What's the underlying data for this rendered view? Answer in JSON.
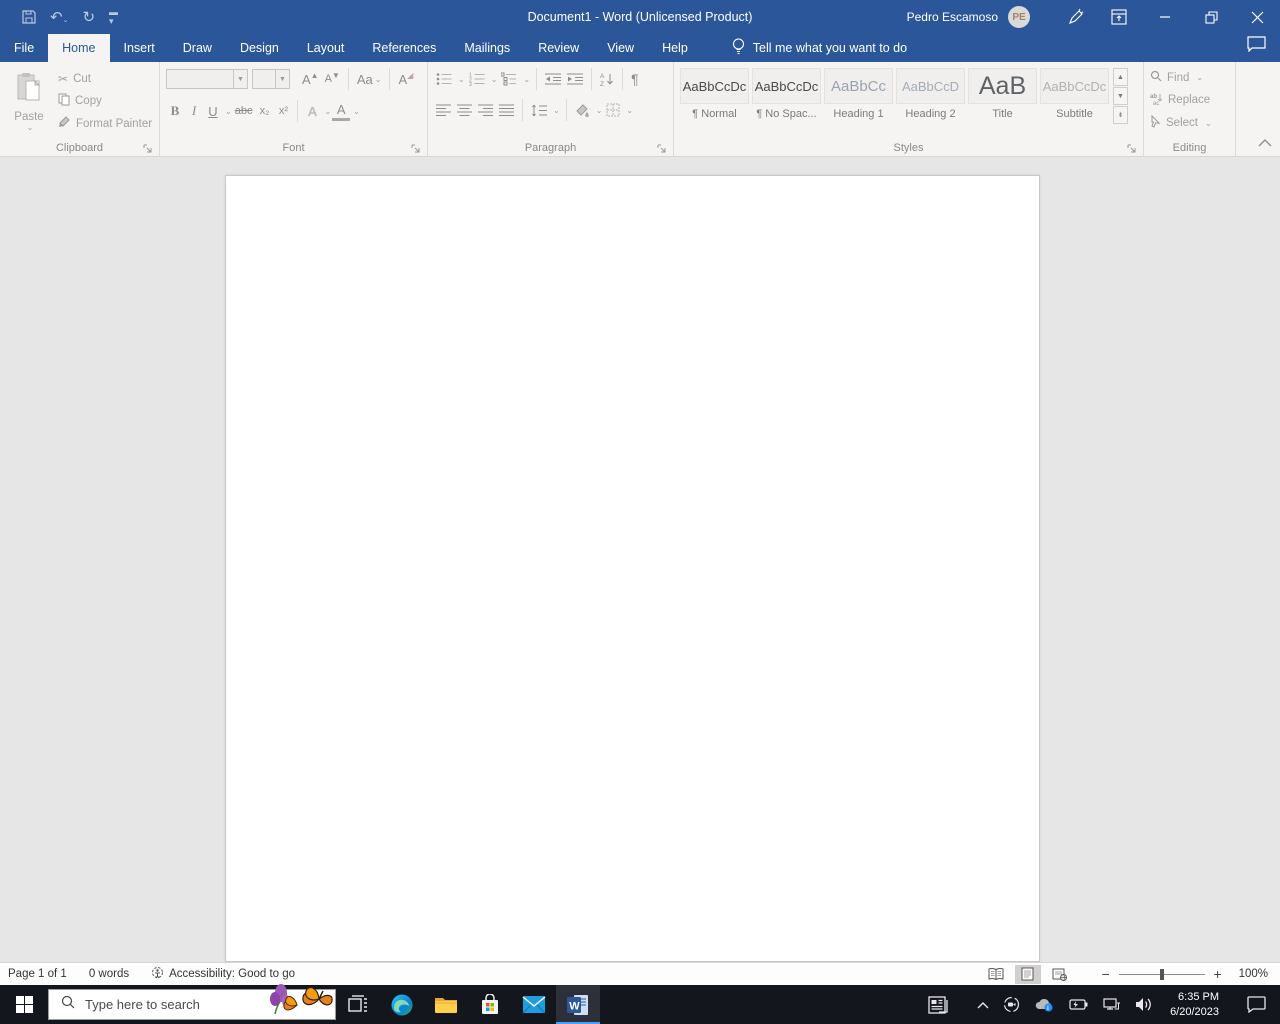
{
  "title_bar": {
    "title": "Document1 - Word (Unlicensed Product)",
    "user_name": "Pedro Escamoso",
    "avatar_initials": "PE"
  },
  "tabs": {
    "items": [
      {
        "label": "File"
      },
      {
        "label": "Home"
      },
      {
        "label": "Insert"
      },
      {
        "label": "Draw"
      },
      {
        "label": "Design"
      },
      {
        "label": "Layout"
      },
      {
        "label": "References"
      },
      {
        "label": "Mailings"
      },
      {
        "label": "Review"
      },
      {
        "label": "View"
      },
      {
        "label": "Help"
      }
    ],
    "active_tab": "Home",
    "tell_me": "Tell me what you want to do"
  },
  "ribbon": {
    "clipboard": {
      "group_label": "Clipboard",
      "paste": "Paste",
      "cut": "Cut",
      "copy": "Copy",
      "format_painter": "Format Painter"
    },
    "font": {
      "group_label": "Font",
      "bold": "B",
      "italic": "I",
      "underline": "U",
      "strikethrough": "abc",
      "subscript": "x₂",
      "superscript": "x²",
      "change_case": "Aa",
      "grow_font": "A",
      "shrink_font": "A",
      "text_effects": "A",
      "font_color": "A",
      "font_name_value": "",
      "font_size_value": ""
    },
    "paragraph": {
      "group_label": "Paragraph",
      "show_hide": "¶"
    },
    "styles": {
      "group_label": "Styles",
      "items": [
        {
          "preview": "AaBbCcDc",
          "label": "¶ Normal"
        },
        {
          "preview": "AaBbCcDc",
          "label": "¶ No Spac..."
        },
        {
          "preview": "AaBbCc",
          "label": "Heading 1"
        },
        {
          "preview": "AaBbCcD",
          "label": "Heading 2"
        },
        {
          "preview": "AaB",
          "label": "Title"
        },
        {
          "preview": "AaBbCcDc",
          "label": "Subtitle"
        }
      ]
    },
    "editing": {
      "group_label": "Editing",
      "find": "Find",
      "replace": "Replace",
      "select": "Select"
    }
  },
  "status_bar": {
    "page_info": "Page 1 of 1",
    "word_count": "0 words",
    "accessibility": "Accessibility: Good to go",
    "zoom_level": "100%"
  },
  "taskbar": {
    "search_placeholder": "Type here to search",
    "time": "6:35 PM",
    "date": "6/20/2023"
  },
  "colors": {
    "word_blue": "#2b579a",
    "ribbon_bg": "#f5f4f2",
    "canvas_bg": "#e7e6e6",
    "taskbar_bg": "#14161d",
    "active_underline": "#4a9eff"
  }
}
